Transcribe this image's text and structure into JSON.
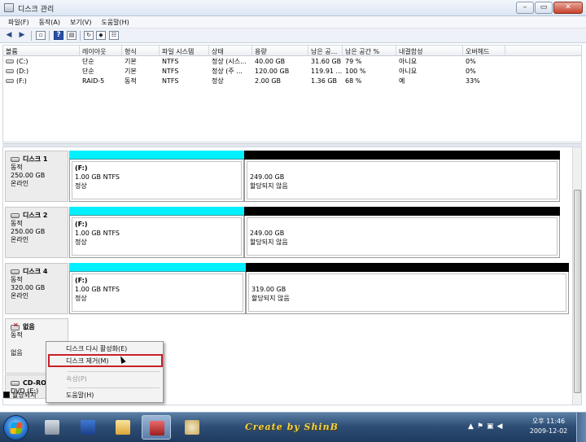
{
  "window": {
    "title": "디스크 관리",
    "buttons": [
      "–",
      "▭",
      "✕"
    ]
  },
  "menu": [
    "파일(F)",
    "동작(A)",
    "보기(V)",
    "도움말(H)"
  ],
  "volume_list": {
    "columns": [
      "볼륨",
      "레이아웃",
      "형식",
      "파일 시스템",
      "상태",
      "용량",
      "남은 공...",
      "남은 공간 %",
      "내결함성",
      "오버헤드"
    ],
    "rows": [
      [
        "(C:)",
        "단순",
        "기본",
        "NTFS",
        "정상 (시스...",
        "40.00 GB",
        "31.60 GB",
        "79 %",
        "아니요",
        "0%"
      ],
      [
        "(D:)",
        "단순",
        "기본",
        "NTFS",
        "정상 (주 ...",
        "120.00 GB",
        "119.91 ...",
        "100 %",
        "아니요",
        "0%"
      ],
      [
        "(F:)",
        "RAID-5",
        "동적",
        "NTFS",
        "정상",
        "2.00 GB",
        "1.36 GB",
        "68 %",
        "예",
        "33%"
      ]
    ]
  },
  "disks": [
    {
      "name": "디스크 1",
      "type": "동적",
      "size": "250.00 GB",
      "status": "온라인",
      "partitions": [
        {
          "name": "(F:)",
          "detail": "1.00 GB NTFS",
          "status": "정상"
        },
        {
          "name": "",
          "detail": "249.00 GB",
          "status": "할당되지 않음"
        }
      ]
    },
    {
      "name": "디스크 2",
      "type": "동적",
      "size": "250.00 GB",
      "status": "온라인",
      "partitions": [
        {
          "name": "(F:)",
          "detail": "1.00 GB NTFS",
          "status": "정상"
        },
        {
          "name": "",
          "detail": "249.00 GB",
          "status": "할당되지 않음"
        }
      ]
    },
    {
      "name": "디스크 4",
      "type": "동적",
      "size": "320.00 GB",
      "status": "온라인",
      "partitions": [
        {
          "name": "(F:)",
          "detail": "1.00 GB NTFS",
          "status": "정상"
        },
        {
          "name": "",
          "detail": "319.00 GB",
          "status": "할당되지 않음"
        }
      ]
    }
  ],
  "missing_disk": {
    "name": "없음",
    "type": "동적",
    "status": "없음"
  },
  "cdrom": {
    "name": "CD-ROI",
    "type": "DVD (E:)"
  },
  "legend": {
    "label": "할당되지"
  },
  "context_menu": {
    "items": [
      {
        "label": "디스크 다시 활성화(E)",
        "enabled": true
      },
      {
        "label": "디스크 제거(M)",
        "enabled": true,
        "highlighted": true
      },
      {
        "label": "속성(P)",
        "enabled": false
      },
      {
        "label": "도움말(H)",
        "enabled": true
      }
    ]
  },
  "taskbar": {
    "credit": "Create by ShinB",
    "clock": {
      "period": "오후 11:46",
      "date": "2009-12-02"
    }
  },
  "colors": {
    "raid5_stripe": "#00f0ff",
    "unallocated_stripe": "#000000",
    "highlight_border": "#c9202a"
  }
}
